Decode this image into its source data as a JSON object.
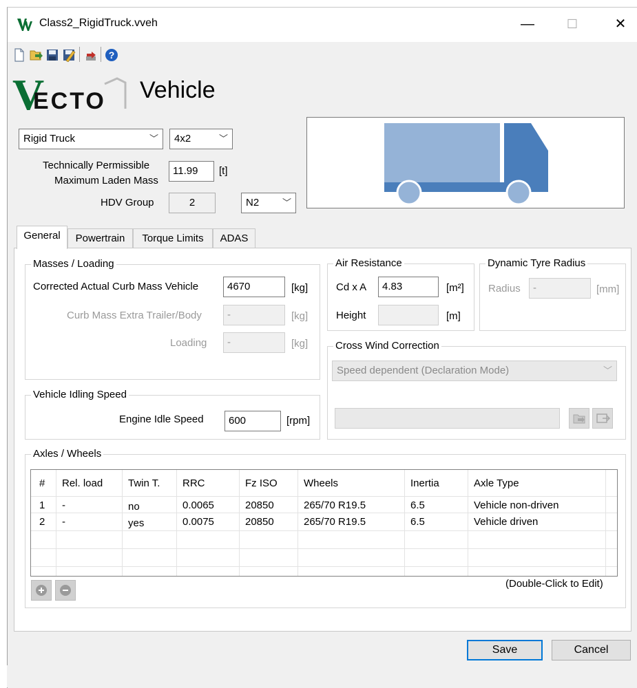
{
  "window": {
    "title": "Class2_RigidTruck.vveh",
    "minimize": "—",
    "maximize": "☐",
    "close": "✕"
  },
  "toolbar": {
    "icons": [
      "new-file-icon",
      "open-file-icon",
      "save-icon",
      "save-as-icon",
      "send-to-job-icon",
      "help-icon"
    ]
  },
  "logo": {
    "v": "V",
    "rest": "ECTO"
  },
  "page": {
    "title": "Vehicle"
  },
  "vehicle": {
    "category": "Rigid Truck",
    "axle_config": "4x2",
    "tpmlm_label_1": "Technically Permissible",
    "tpmlm_label_2": "Maximum Laden Mass",
    "tpmlm_value": "11.99",
    "tpmlm_unit": "[t]",
    "hdv_group_label": "HDV Group",
    "hdv_group_value": "2",
    "vehicle_class": "N2"
  },
  "tabs": [
    "General",
    "Powertrain",
    "Torque Limits",
    "ADAS"
  ],
  "masses": {
    "title": "Masses / Loading",
    "curb_label": "Corrected Actual Curb Mass Vehicle",
    "curb_value": "4670",
    "curb_unit": "[kg]",
    "extra_label": "Curb Mass Extra Trailer/Body",
    "extra_value": "-",
    "extra_unit": "[kg]",
    "loading_label": "Loading",
    "loading_value": "-",
    "loading_unit": "[kg]"
  },
  "idling": {
    "title": "Vehicle Idling Speed",
    "label": "Engine Idle Speed",
    "value": "600",
    "unit": "[rpm]"
  },
  "air": {
    "title": "Air Resistance",
    "cda_label": "Cd x A",
    "cda_value": "4.83",
    "cda_unit": "[m²]",
    "height_label": "Height",
    "height_value": "",
    "height_unit": "[m]"
  },
  "tyre": {
    "title": "Dynamic Tyre Radius",
    "radius_label": "Radius",
    "radius_value": "-",
    "radius_unit": "[mm]"
  },
  "crosswind": {
    "title": "Cross Wind Correction",
    "mode": "Speed dependent (Declaration Mode)",
    "file": ""
  },
  "axles": {
    "title": "Axles / Wheels",
    "columns": [
      "#",
      "Rel. load",
      "Twin T.",
      "RRC",
      "Fz ISO",
      "Wheels",
      "Inertia",
      "Axle Type"
    ],
    "rows": [
      [
        "1",
        "-",
        "no",
        "0.0065",
        "20850",
        "265/70 R19.5",
        "6.5",
        "Vehicle non-driven"
      ],
      [
        "2",
        "-",
        "yes",
        "0.0075",
        "20850",
        "265/70 R19.5",
        "6.5",
        "Vehicle driven"
      ]
    ],
    "hint": "(Double-Click to Edit)"
  },
  "buttons": {
    "save": "Save",
    "cancel": "Cancel"
  },
  "colors": {
    "logo_green": "#0a6e33",
    "truck_cab": "#4a7ebb",
    "truck_body": "#95b3d7",
    "accent": "#0078d7"
  }
}
